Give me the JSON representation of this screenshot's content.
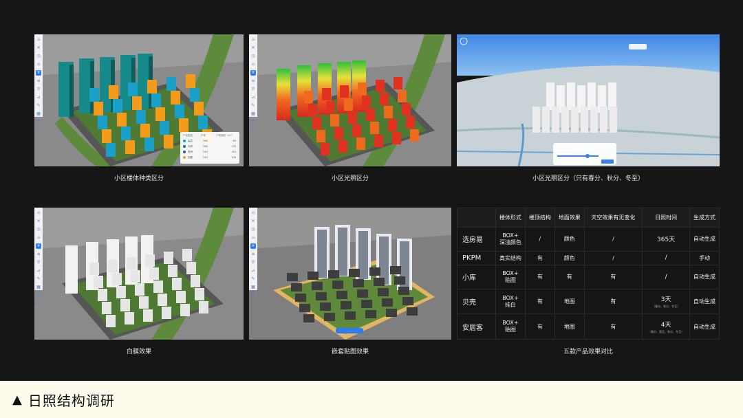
{
  "panels": [
    {
      "caption": "小区楼体种类区分"
    },
    {
      "caption": "小区光照区分"
    },
    {
      "caption": "小区光照区分（只有春分、秋分、冬至）"
    },
    {
      "caption": "白膜效果"
    },
    {
      "caption": "嵌套贴图效果"
    },
    {
      "caption": "五款产品效果对比"
    }
  ],
  "legend": {
    "headers": [
      "户型类型",
      "户数",
      "户型面积（m²）"
    ],
    "rows": [
      {
        "name": "高层",
        "count": "288",
        "area": "89",
        "color": "#1aa0c8"
      },
      {
        "name": "洋房",
        "count": "288",
        "area": "135",
        "color": "#0f7a76"
      },
      {
        "name": "叠拼",
        "count": "240",
        "area": "118",
        "color": "#1b5fb5"
      },
      {
        "name": "别墅",
        "count": "240",
        "area": "106",
        "color": "#f39c1b"
      }
    ]
  },
  "toolbar_icons": [
    "home-icon",
    "close-icon",
    "clock-icon",
    "home-icon",
    "sun-icon",
    "layers-icon",
    "pin-icon",
    "ruler-icon",
    "edit-icon",
    "grid-icon",
    "filter-icon",
    "download-icon"
  ],
  "comparison": {
    "headers": [
      "",
      "楼体形式",
      "楼顶结构",
      "地面效果",
      "天空效果有无变化",
      "日照时间",
      "生成方式"
    ],
    "rows": [
      {
        "name": "选房易",
        "form": "BOX+\n深浅颜色",
        "roof": "/",
        "ground": "颜色",
        "sky": "/",
        "sun": "365天",
        "sun_note": "",
        "gen": "自动生成"
      },
      {
        "name": "PKPM",
        "form": "真实结构",
        "roof": "有",
        "ground": "颜色",
        "sky": "/",
        "sun": "/",
        "sun_note": "",
        "gen": "手动"
      },
      {
        "name": "小库",
        "form": "BOX+\n贴图",
        "roof": "有",
        "ground": "有",
        "sky": "有",
        "sun": "/",
        "sun_note": "",
        "gen": "自动生成"
      },
      {
        "name": "贝壳",
        "form": "BOX+\n纯白",
        "roof": "有",
        "ground": "地图",
        "sky": "有",
        "sun": "3天",
        "sun_note": "（春分、秋分、冬至）",
        "gen": "自动生成"
      },
      {
        "name": "安居客",
        "form": "BOX+\n贴图",
        "roof": "有",
        "ground": "地图",
        "sky": "有",
        "sun": "4天",
        "sun_note": "（春分、夏至、秋分、冬至）",
        "gen": "自动生成"
      }
    ]
  },
  "footer": {
    "triangle": "▲",
    "title": "日照结构调研"
  },
  "colors": {
    "background": "#161616",
    "footer_bg": "#fdfbec",
    "teal": "#0f7a76",
    "cyan": "#1aa0c8",
    "orange": "#f39c1b"
  }
}
